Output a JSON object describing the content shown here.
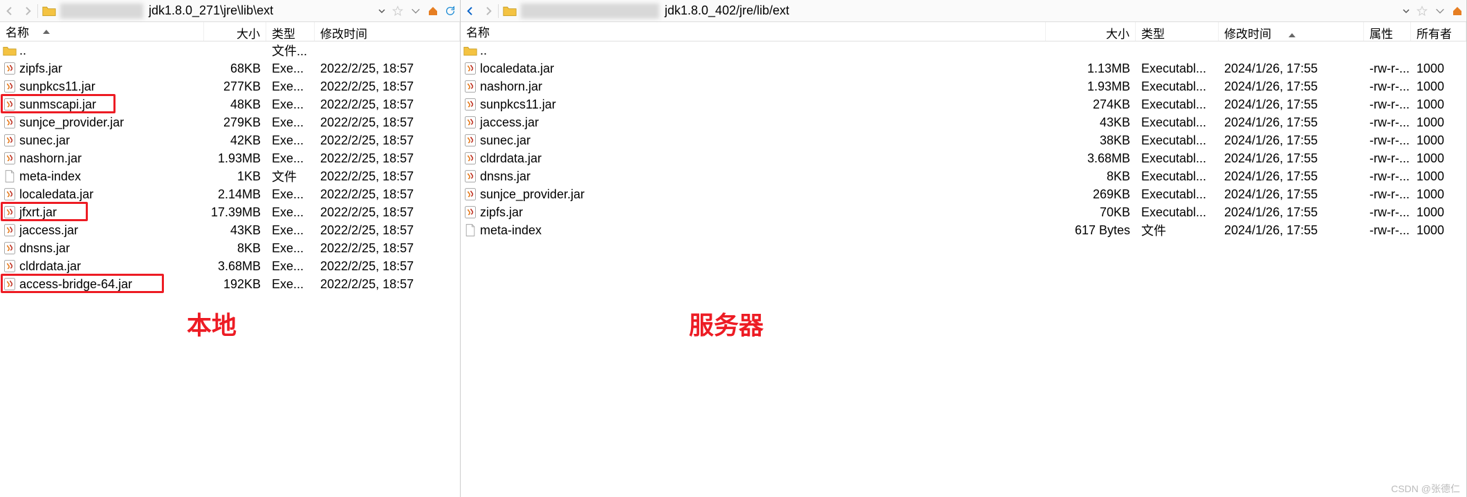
{
  "left": {
    "path": "jdk1.8.0_271\\jre\\lib\\ext",
    "label": "本地",
    "headers": {
      "name": "名称",
      "size": "大小",
      "type": "类型",
      "modified": "修改时间"
    },
    "files": [
      {
        "icon": "folder-up",
        "name": "..",
        "size": "",
        "type": "文件...",
        "mod": "",
        "hl": false
      },
      {
        "icon": "jar",
        "name": "zipfs.jar",
        "size": "68KB",
        "type": "Exe...",
        "mod": "2022/2/25, 18:57",
        "hl": false
      },
      {
        "icon": "jar",
        "name": "sunpkcs11.jar",
        "size": "277KB",
        "type": "Exe...",
        "mod": "2022/2/25, 18:57",
        "hl": false
      },
      {
        "icon": "jar",
        "name": "sunmscapi.jar",
        "size": "48KB",
        "type": "Exe...",
        "mod": "2022/2/25, 18:57",
        "hl": true
      },
      {
        "icon": "jar",
        "name": "sunjce_provider.jar",
        "size": "279KB",
        "type": "Exe...",
        "mod": "2022/2/25, 18:57",
        "hl": false
      },
      {
        "icon": "jar",
        "name": "sunec.jar",
        "size": "42KB",
        "type": "Exe...",
        "mod": "2022/2/25, 18:57",
        "hl": false
      },
      {
        "icon": "jar",
        "name": "nashorn.jar",
        "size": "1.93MB",
        "type": "Exe...",
        "mod": "2022/2/25, 18:57",
        "hl": false
      },
      {
        "icon": "file",
        "name": "meta-index",
        "size": "1KB",
        "type": "文件",
        "mod": "2022/2/25, 18:57",
        "hl": false
      },
      {
        "icon": "jar",
        "name": "localedata.jar",
        "size": "2.14MB",
        "type": "Exe...",
        "mod": "2022/2/25, 18:57",
        "hl": false
      },
      {
        "icon": "jar",
        "name": "jfxrt.jar",
        "size": "17.39MB",
        "type": "Exe...",
        "mod": "2022/2/25, 18:57",
        "hl": true
      },
      {
        "icon": "jar",
        "name": "jaccess.jar",
        "size": "43KB",
        "type": "Exe...",
        "mod": "2022/2/25, 18:57",
        "hl": false
      },
      {
        "icon": "jar",
        "name": "dnsns.jar",
        "size": "8KB",
        "type": "Exe...",
        "mod": "2022/2/25, 18:57",
        "hl": false
      },
      {
        "icon": "jar",
        "name": "cldrdata.jar",
        "size": "3.68MB",
        "type": "Exe...",
        "mod": "2022/2/25, 18:57",
        "hl": false
      },
      {
        "icon": "jar",
        "name": "access-bridge-64.jar",
        "size": "192KB",
        "type": "Exe...",
        "mod": "2022/2/25, 18:57",
        "hl": true
      }
    ]
  },
  "right": {
    "path": "jdk1.8.0_402/jre/lib/ext",
    "label": "服务器",
    "headers": {
      "name": "名称",
      "size": "大小",
      "type": "类型",
      "modified": "修改时间",
      "attrs": "属性",
      "owner": "所有者"
    },
    "files": [
      {
        "icon": "folder-up",
        "name": "..",
        "size": "",
        "type": "",
        "mod": "",
        "attrs": "",
        "owner": ""
      },
      {
        "icon": "jar",
        "name": "localedata.jar",
        "size": "1.13MB",
        "type": "Executabl...",
        "mod": "2024/1/26, 17:55",
        "attrs": "-rw-r-...",
        "owner": "1000"
      },
      {
        "icon": "jar",
        "name": "nashorn.jar",
        "size": "1.93MB",
        "type": "Executabl...",
        "mod": "2024/1/26, 17:55",
        "attrs": "-rw-r-...",
        "owner": "1000"
      },
      {
        "icon": "jar",
        "name": "sunpkcs11.jar",
        "size": "274KB",
        "type": "Executabl...",
        "mod": "2024/1/26, 17:55",
        "attrs": "-rw-r-...",
        "owner": "1000"
      },
      {
        "icon": "jar",
        "name": "jaccess.jar",
        "size": "43KB",
        "type": "Executabl...",
        "mod": "2024/1/26, 17:55",
        "attrs": "-rw-r-...",
        "owner": "1000"
      },
      {
        "icon": "jar",
        "name": "sunec.jar",
        "size": "38KB",
        "type": "Executabl...",
        "mod": "2024/1/26, 17:55",
        "attrs": "-rw-r-...",
        "owner": "1000"
      },
      {
        "icon": "jar",
        "name": "cldrdata.jar",
        "size": "3.68MB",
        "type": "Executabl...",
        "mod": "2024/1/26, 17:55",
        "attrs": "-rw-r-...",
        "owner": "1000"
      },
      {
        "icon": "jar",
        "name": "dnsns.jar",
        "size": "8KB",
        "type": "Executabl...",
        "mod": "2024/1/26, 17:55",
        "attrs": "-rw-r-...",
        "owner": "1000"
      },
      {
        "icon": "jar",
        "name": "sunjce_provider.jar",
        "size": "269KB",
        "type": "Executabl...",
        "mod": "2024/1/26, 17:55",
        "attrs": "-rw-r-...",
        "owner": "1000"
      },
      {
        "icon": "jar",
        "name": "zipfs.jar",
        "size": "70KB",
        "type": "Executabl...",
        "mod": "2024/1/26, 17:55",
        "attrs": "-rw-r-...",
        "owner": "1000"
      },
      {
        "icon": "file",
        "name": "meta-index",
        "size": "617 Bytes",
        "type": "文件",
        "mod": "2024/1/26, 17:55",
        "attrs": "-rw-r-...",
        "owner": "1000"
      }
    ]
  },
  "watermark": "CSDN @张德仁"
}
